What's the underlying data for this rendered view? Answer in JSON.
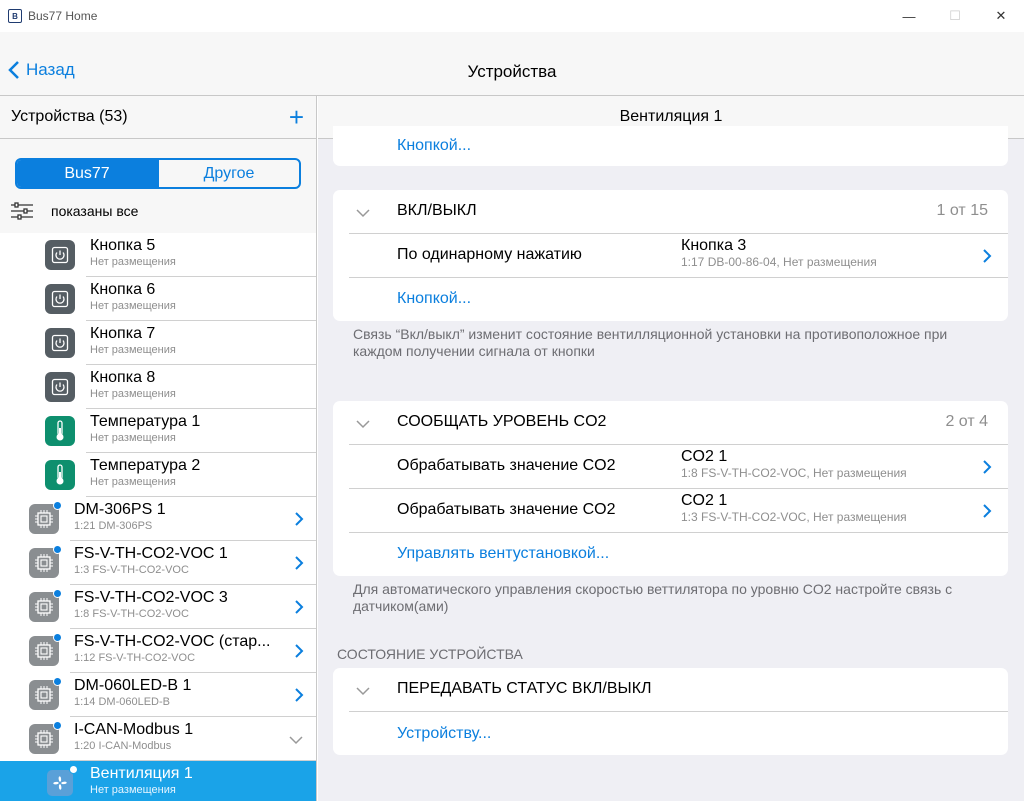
{
  "window": {
    "title": "Bus77 Home",
    "minimize": "—",
    "maximize": "☐",
    "close": "✕"
  },
  "nav": {
    "back": "Назад",
    "title": "Устройства"
  },
  "left": {
    "header": "Устройства (53)",
    "add": "+",
    "segments": [
      "Bus77",
      "Другое"
    ],
    "filter": "показаны все",
    "items": [
      {
        "title": "Кнопка 5",
        "sub": "Нет размещения",
        "icon": "power-icon"
      },
      {
        "title": "Кнопка 6",
        "sub": "Нет размещения",
        "icon": "power-icon"
      },
      {
        "title": "Кнопка 7",
        "sub": "Нет размещения",
        "icon": "power-icon"
      },
      {
        "title": "Кнопка 8",
        "sub": "Нет размещения",
        "icon": "power-icon"
      },
      {
        "title": "Температура 1",
        "sub": "Нет размещения",
        "icon": "thermometer-icon"
      },
      {
        "title": "Температура 2",
        "sub": "Нет размещения",
        "icon": "thermometer-icon"
      }
    ],
    "devices": [
      {
        "title": "DM-306PS 1",
        "sub": "1:21 DM-306PS"
      },
      {
        "title": "FS-V-TH-CO2-VOC 1",
        "sub": "1:3 FS-V-TH-CO2-VOC"
      },
      {
        "title": "FS-V-TH-CO2-VOC 3",
        "sub": "1:8 FS-V-TH-CO2-VOC"
      },
      {
        "title": "FS-V-TH-CO2-VOC (стар...",
        "sub": "1:12 FS-V-TH-CO2-VOC"
      },
      {
        "title": "DM-060LED-B 1",
        "sub": "1:14 DM-060LED-B"
      },
      {
        "title": "I-CAN-Modbus 1",
        "sub": "1:20 I-CAN-Modbus"
      }
    ],
    "selected": {
      "title": "Вентиляция 1",
      "sub": "Нет размещения"
    }
  },
  "right": {
    "header": "Вентиляция 1",
    "top_link": "Кнопкой...",
    "onoff": {
      "label": "ВКЛ/ВЫКЛ",
      "count": "1 от 15",
      "item_label": "По одинарному нажатию",
      "item_value": "Кнопка 3",
      "item_sub": "1:17 DB-00-86-04, Нет размещения",
      "link": "Кнопкой...",
      "note": "Связь “Вкл/выкл” изменит состояние вентилляционной установки на противоположное при каждом получении сигнала от кнопки"
    },
    "co2": {
      "label": "СООБЩАТЬ УРОВЕНЬ CO2",
      "count": "2 от 4",
      "items": [
        {
          "label": "Обрабатывать значение CO2",
          "value": "CO2 1",
          "sub": "1:8 FS-V-TH-CO2-VOC, Нет размещения"
        },
        {
          "label": "Обрабатывать значение CO2",
          "value": "CO2 1",
          "sub": "1:3 FS-V-TH-CO2-VOC, Нет размещения"
        }
      ],
      "link": "Управлять вентустановкой...",
      "note": "Для автоматического управления скоростью веттилятора по уровню CO2 настройте связь с датчиком(ами)"
    },
    "status_header": "СОСТОЯНИЕ УСТРОЙСТВА",
    "status": {
      "label": "ПЕРЕДАВАТЬ СТАТУС ВКЛ/ВЫКЛ",
      "link": "Устройству..."
    }
  }
}
